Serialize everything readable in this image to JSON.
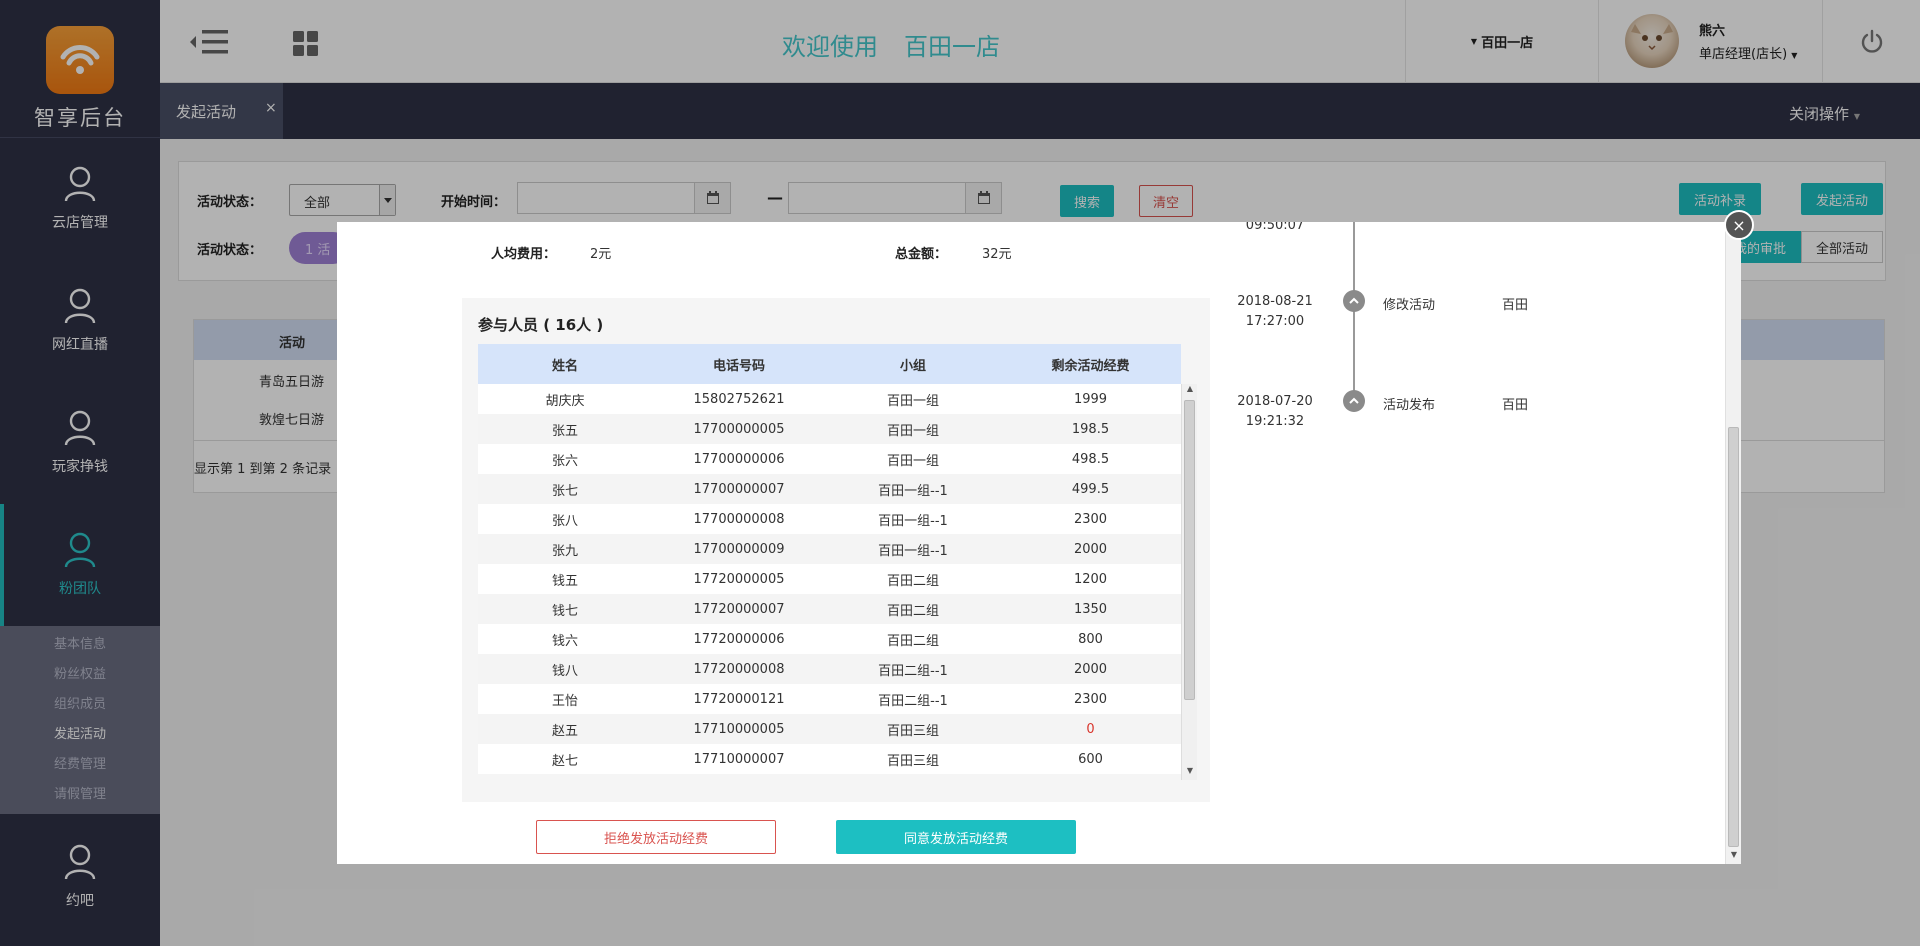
{
  "sidebar": {
    "logo_text": "智享后台",
    "items": [
      {
        "label": "云店管理"
      },
      {
        "label": "网红直播"
      },
      {
        "label": "玩家挣钱"
      },
      {
        "label": "粉团队"
      },
      {
        "label": "约吧"
      }
    ],
    "subitems": [
      "基本信息",
      "粉丝权益",
      "组织成员",
      "发起活动",
      "经费管理",
      "请假管理"
    ]
  },
  "header": {
    "welcome": "欢迎使用",
    "store_name": "百田一店",
    "store_dropdown": "百田一店",
    "user_name": "熊六",
    "user_role": "单店经理(店长)"
  },
  "tabbar": {
    "active_tab": "发起活动",
    "close_symbol": "×",
    "close_ops": "关闭操作"
  },
  "filters": {
    "status_label": "活动状态：",
    "status_value": "全部",
    "start_time_label": "开始时间：",
    "dash": "—",
    "search_btn": "搜索",
    "clear_btn": "清空",
    "supplement_btn": "活动补录",
    "launch_btn": "发起活动",
    "status_label2": "活动状态：",
    "pill_text": "1 活",
    "my_review_btn": "我的审批",
    "all_btn": "全部活动"
  },
  "bg_table": {
    "header": "活动",
    "rows": [
      "青岛五日游",
      "敦煌七日游"
    ],
    "footer": "显示第 1 到第 2 条记录"
  },
  "modal": {
    "close_symbol": "×",
    "per_cost_label": "人均费用：",
    "per_cost_value": "2元",
    "total_label": "总金额：",
    "total_value": "32元",
    "members_title": "参与人员 ( 16人 )",
    "columns": [
      "姓名",
      "电话号码",
      "小组",
      "剩余活动经费"
    ],
    "rows": [
      {
        "name": "胡庆庆",
        "phone": "15802752621",
        "group": "百田一组",
        "fund": "1999"
      },
      {
        "name": "张五",
        "phone": "17700000005",
        "group": "百田一组",
        "fund": "198.5"
      },
      {
        "name": "张六",
        "phone": "17700000006",
        "group": "百田一组",
        "fund": "498.5"
      },
      {
        "name": "张七",
        "phone": "17700000007",
        "group": "百田一组--1",
        "fund": "499.5"
      },
      {
        "name": "张八",
        "phone": "17700000008",
        "group": "百田一组--1",
        "fund": "2300"
      },
      {
        "name": "张九",
        "phone": "17700000009",
        "group": "百田一组--1",
        "fund": "2000"
      },
      {
        "name": "钱五",
        "phone": "17720000005",
        "group": "百田二组",
        "fund": "1200"
      },
      {
        "name": "钱七",
        "phone": "17720000007",
        "group": "百田二组",
        "fund": "1350"
      },
      {
        "name": "钱六",
        "phone": "17720000006",
        "group": "百田二组",
        "fund": "800"
      },
      {
        "name": "钱八",
        "phone": "17720000008",
        "group": "百田二组--1",
        "fund": "2000"
      },
      {
        "name": "王怡",
        "phone": "17720000121",
        "group": "百田二组--1",
        "fund": "2300"
      },
      {
        "name": "赵五",
        "phone": "17710000005",
        "group": "百田三组",
        "fund": "0"
      },
      {
        "name": "赵七",
        "phone": "17710000007",
        "group": "百田三组",
        "fund": "600"
      }
    ],
    "timeline": [
      {
        "date": "2018-08-21",
        "time": "17:27:00",
        "action": "修改活动",
        "who": "百田"
      },
      {
        "date": "2018-07-20",
        "time": "19:21:32",
        "action": "活动发布",
        "who": "百田"
      }
    ],
    "timeline_top_partial": "09:50:07",
    "reject_btn": "拒绝发放活动经费",
    "approve_btn": "同意发放活动经费"
  },
  "colors": {
    "sidebar_bg": "#2f3146",
    "accent": "#1dbfc2",
    "danger": "#d9534f",
    "table_head": "#d6e4fa"
  }
}
